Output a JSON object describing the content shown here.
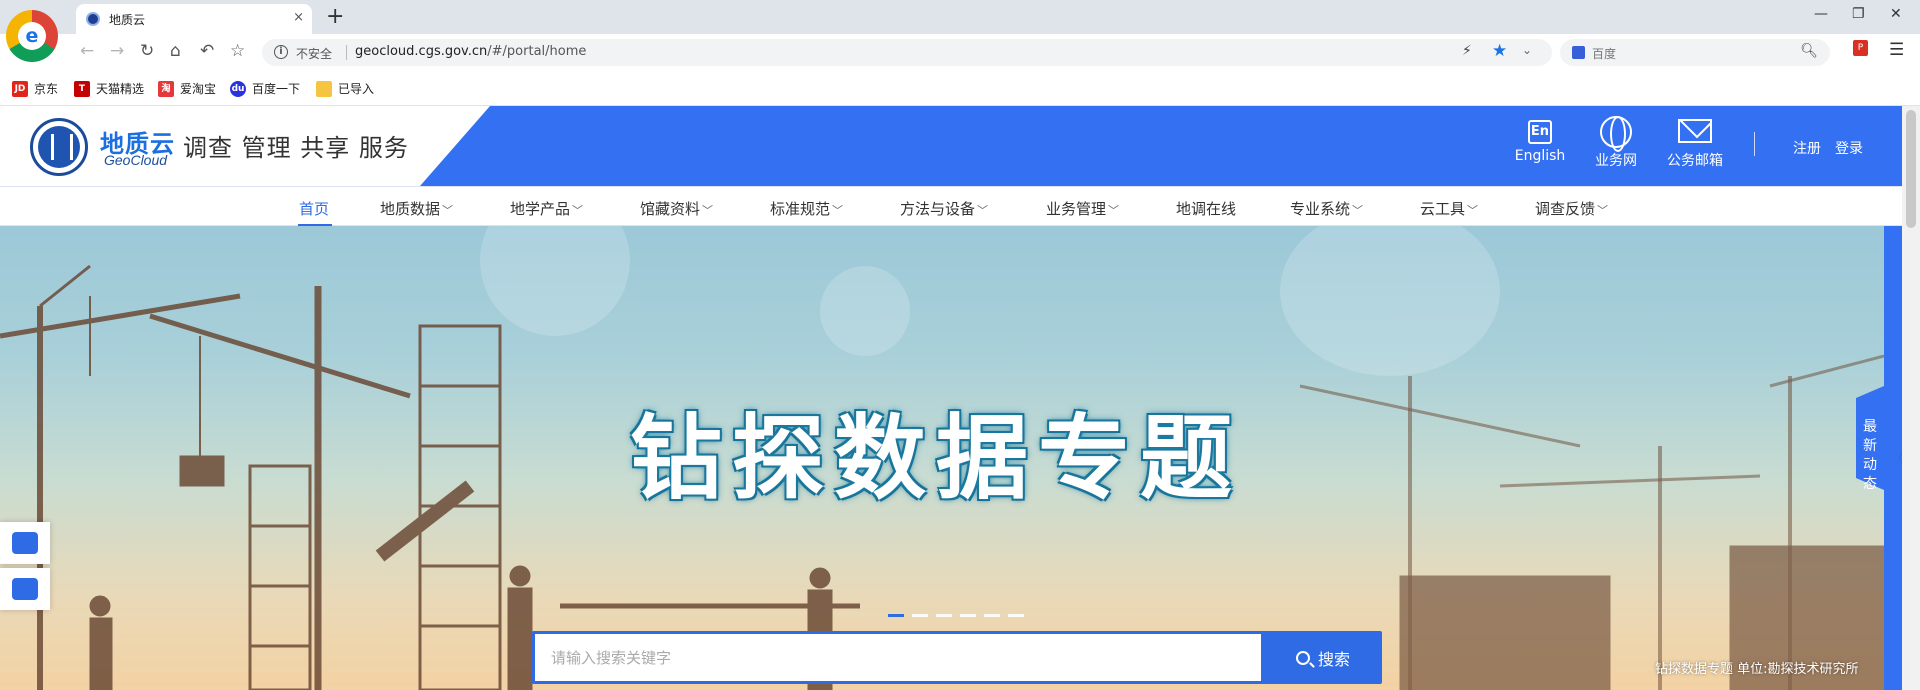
{
  "browser": {
    "tab_title": "地质云",
    "tab_close": "×",
    "new_tab": "+",
    "window_controls": [
      "—",
      "❐",
      "✕"
    ],
    "url_security": "不安全",
    "url_host": "geocloud.cgs.gov.cn",
    "url_path": "/#/portal/home",
    "search_engine_placeholder": "百度",
    "bookmarks": [
      {
        "label": "京东",
        "icon": "jd-icon",
        "color": "#e1251b"
      },
      {
        "label": "天猫精选",
        "icon": "tmall-icon",
        "color": "#c40000"
      },
      {
        "label": "爱淘宝",
        "icon": "aitaobao-icon",
        "color": "#e4393c"
      },
      {
        "label": "百度一下",
        "icon": "baidu-paw-icon",
        "color": "#2932e1"
      },
      {
        "label": "已导入",
        "icon": "folder-icon",
        "color": "#f5c542"
      }
    ]
  },
  "site": {
    "logo_cn": "地质云",
    "logo_en": "GeoCloud",
    "slogan": "调查 管理 共享 服务",
    "header_actions": [
      {
        "label": "English",
        "icon": "english-icon"
      },
      {
        "label": "业务网",
        "icon": "globe-icon"
      },
      {
        "label": "公务邮箱",
        "icon": "mail-icon"
      }
    ],
    "register": "注册",
    "login": "登录",
    "nav": [
      {
        "label": "首页",
        "dropdown": false,
        "active": true
      },
      {
        "label": "地质数据",
        "dropdown": true
      },
      {
        "label": "地学产品",
        "dropdown": true
      },
      {
        "label": "馆藏资料",
        "dropdown": true
      },
      {
        "label": "标准规范",
        "dropdown": true
      },
      {
        "label": "方法与设备",
        "dropdown": true
      },
      {
        "label": "业务管理",
        "dropdown": true
      },
      {
        "label": "地调在线",
        "dropdown": false
      },
      {
        "label": "专业系统",
        "dropdown": true
      },
      {
        "label": "云工具",
        "dropdown": true
      },
      {
        "label": "调查反馈",
        "dropdown": true
      }
    ],
    "nav_caret": "﹀",
    "banner": {
      "title": "钻探数据专题",
      "caption": "钻探数据专题 单位:勘探技术研究所",
      "slide_count": 6,
      "active_slide": 1
    },
    "search": {
      "placeholder": "请输入搜索关键字",
      "button": "搜索"
    },
    "side_news_label": "最新动态",
    "side_arrow": "《",
    "accent_color": "#3471f2"
  }
}
